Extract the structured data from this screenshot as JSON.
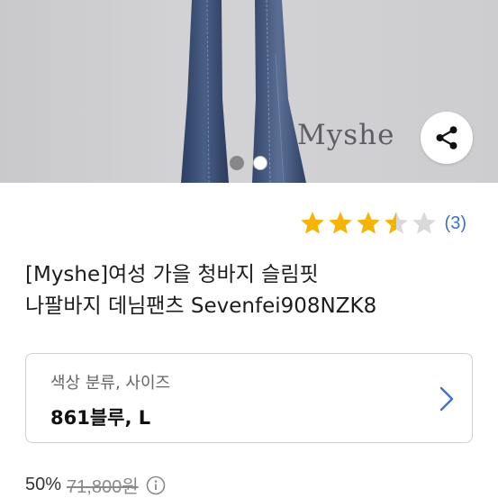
{
  "hero": {
    "watermark": "Myshe",
    "carousel": {
      "total": 2,
      "active_index": 1
    },
    "share_icon": "share-icon"
  },
  "rating": {
    "stars": 3.5,
    "max_stars": 5,
    "count": "(3)",
    "star_color": "#f6b400",
    "empty_star_color": "#d9d9d9"
  },
  "product": {
    "title_line1": "[Myshe]여성 가을 청바지 슬림핏",
    "title_line2": "나팔바지 데님팬츠 Sevenfei908NZK8"
  },
  "option": {
    "label": "색상 분류, 사이즈",
    "value": "861블루, L",
    "arrow_icon": "chevron-right-icon",
    "arrow_color": "#3f6fce"
  },
  "price": {
    "discount": "50%",
    "original": "71,800원",
    "info_icon": "info-icon"
  }
}
